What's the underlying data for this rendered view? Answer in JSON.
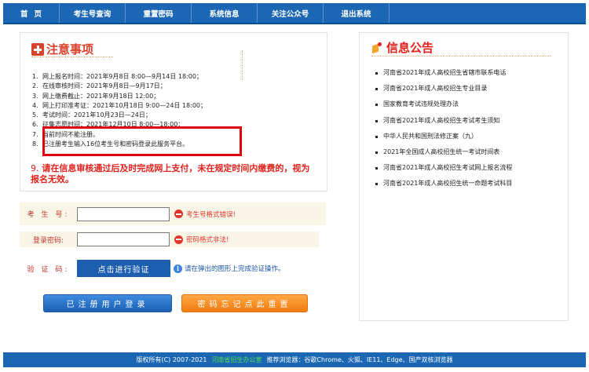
{
  "nav": {
    "items": [
      {
        "label": "首页"
      },
      {
        "label": "考生号查询"
      },
      {
        "label": "重置密码"
      },
      {
        "label": "系统信息"
      },
      {
        "label": "关注公众号"
      },
      {
        "label": "退出系统"
      }
    ]
  },
  "notice": {
    "title": "注意事项",
    "items": [
      {
        "num": "1.",
        "text": "网上报名时间：2021年9月8日 8:00—9月14日 18:00；"
      },
      {
        "num": "2.",
        "text": "在线审核时间：2021年9月8日—9月17日；"
      },
      {
        "num": "3.",
        "text": "网上缴费截止：2021年9月18日 12:00；"
      },
      {
        "num": "4.",
        "text": "网上打印准考证：2021年10月18日 9:00—24日 18:00；"
      },
      {
        "num": "5.",
        "text": "考试时间：2021年10月23日—24日；"
      },
      {
        "num": "6.",
        "text": "征集志愿时间：2021年12月10日 8:00—18:00；"
      },
      {
        "num": "7.",
        "text": "当前时间不能注册。"
      },
      {
        "num": "8.",
        "text": "已注册考生输入16位考生号和密码登录此服务平台。"
      }
    ],
    "warning_num": "9.",
    "warning_text": "请在信息审核通过后及时完成网上支付，未在规定时间内缴费的，视为报名无效。"
  },
  "form": {
    "exam_no_label": "考 生 号:",
    "exam_no_value": "",
    "exam_no_error": "考生号格式错误!",
    "password_label": "登录密码:",
    "password_value": "",
    "password_error": "密码格式非法!",
    "captcha_label": "验 证 码:",
    "captcha_button": "点击进行验证",
    "captcha_hint": "请在弹出的图形上完成验证操作。",
    "login_button": "已注册用户登录",
    "reset_button": "密码忘记点此重置"
  },
  "info": {
    "title": "信息公告",
    "items": [
      {
        "text": "河南省2021年成人高校招生省辖市联系电话"
      },
      {
        "text": "河南省2021年成人高校招生专业目录"
      },
      {
        "text": "国家教育考试违规处理办法"
      },
      {
        "text": "河南省2021年成人高校招生考试考生须知"
      },
      {
        "text": "中华人民共和国刑法修正案（九）"
      },
      {
        "text": "2021年全国成人高校招生统一考试时间表"
      },
      {
        "text": "河南省2021年成人高校招生考试网上报名流程"
      },
      {
        "text": "河南省2021年成人高校招生统一命题考试科目"
      }
    ]
  },
  "footer": {
    "copyright": "版权所有(C) 2007-2021",
    "office_link": "河南省招生办公室",
    "browsers": "推荐浏览器：谷歌Chrome、火狐、IE11、Edge、国产双核浏览器"
  },
  "colors": {
    "nav_blue": "#1c67b4",
    "warning_red": "#e2211c",
    "login_blue": "#1a5fb3",
    "reset_orange": "#f07d0e",
    "footer_link_green": "#4ee04e"
  }
}
